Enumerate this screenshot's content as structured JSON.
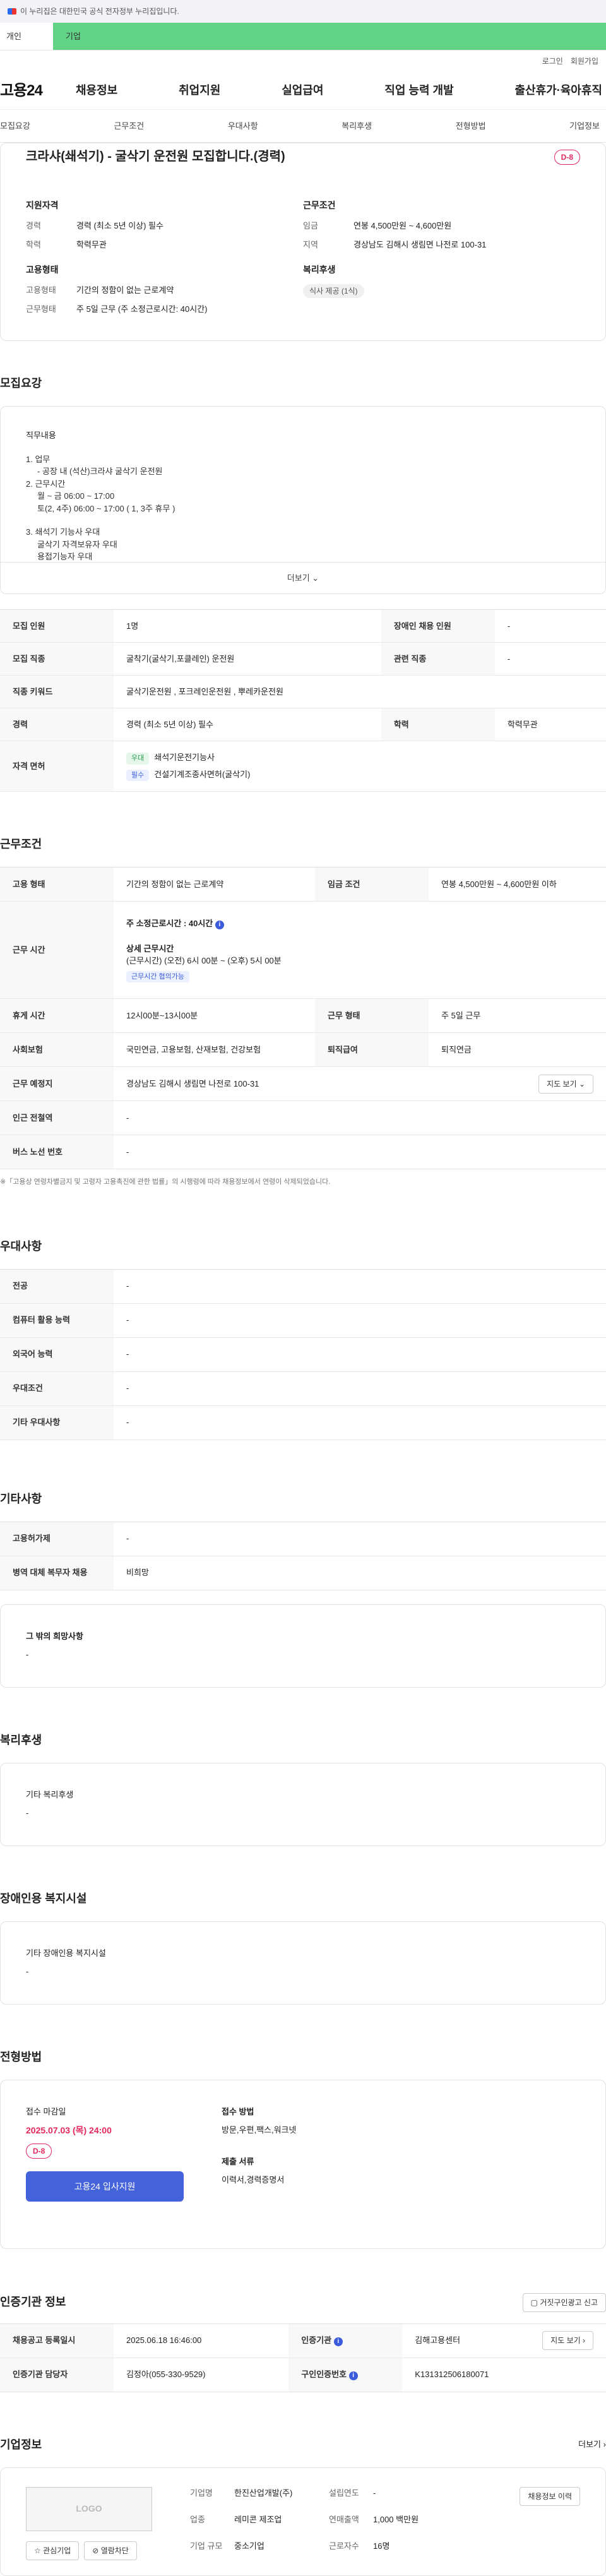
{
  "gov_bar": {
    "text": "이 누리집은 대한민국 공식 전자정부 누리집입니다."
  },
  "user_tabs": {
    "personal": "개인",
    "company": "기업"
  },
  "util": {
    "login": "로그인",
    "join": "회원가입"
  },
  "gnb": {
    "logo": "고용24",
    "items": [
      "채용정보",
      "취업지원",
      "실업급여",
      "직업 능력 개발",
      "출산휴가·육아휴직"
    ]
  },
  "snb": {
    "items": [
      "모집요강",
      "근무조건",
      "우대사항",
      "복리후생",
      "전형방법",
      "기업정보"
    ]
  },
  "top": {
    "title": "크라샤(쇄석기) - 굴삭기 운전원 모집합니다.(경력)",
    "dday": "D-8",
    "qualify_title": "지원자격",
    "career_k": "경력",
    "career_v": "경력 (최소 5년 이상) 필수",
    "edu_k": "학력",
    "edu_v": "학력무관",
    "employ_title": "고용형태",
    "etype_k": "고용형태",
    "etype_v": "기간의 정함이 없는 근로계약",
    "wtype_k": "근무형태",
    "wtype_v": "주 5일 근무 (주 소정근로시간: 40시간)",
    "cond_title": "근무조건",
    "wage_k": "임금",
    "wage_v": "연봉 4,500만원 ~ 4,600만원",
    "area_k": "지역",
    "area_v": "경상남도 김해시 생림면 나전로 100-31",
    "welfare_title": "복리후생",
    "welfare_pill": "식사 제공 (1식)"
  },
  "recruit": {
    "section_title": "모집요강",
    "duty_label": "직무내용",
    "lines": [
      "1. 업무",
      "- 공장 내 (석산)크라샤 굴삭기 운전원",
      "2. 근무시간",
      "월 ~ 금 06:00 ~ 17:00",
      "토(2, 4주) 06:00 ~ 17:00 ( 1, 3주 휴무 )",
      "3. 쇄석기 기능사 우대",
      "굴삭기 자격보유자 우대",
      "용접기능자 우대"
    ],
    "more": "더보기",
    "table": {
      "r1": [
        "모집 인원",
        "1명",
        "장애인 채용 인원",
        "-"
      ],
      "r2": [
        "모집 직종",
        "굴착기(굴삭기,포클레인) 운전원",
        "관련 직종",
        "-"
      ],
      "r3": [
        "직종 키워드",
        "굴삭기운전원 , 포크레인운전원 , 뿌레카운전원"
      ],
      "r4": [
        "경력",
        "경력 (최소 5년 이상) 필수",
        "학력",
        "학력무관"
      ],
      "r5_k": "자격 면허",
      "lic1_badge": "우대",
      "lic1": "쇄석기운전기능사",
      "lic2_badge": "필수",
      "lic2": "건설기계조종사면허(굴삭기)"
    }
  },
  "work": {
    "section_title": "근무조건",
    "etype": [
      "고용 형태",
      "기간의 정함이 없는 근로계약",
      "임금 조건",
      "연봉 4,500만원 ~ 4,600만원 이하"
    ],
    "hours_k": "근무 시간",
    "hours_main": "주 소정근로시간 : 40시간",
    "hours_detail_title": "상세 근무시간",
    "hours_detail": "(근무시간) (오전) 6시 00분 ~ (오후) 5시 00분",
    "hours_tag": "근무시간 협의가능",
    "rest": [
      "휴게 시간",
      "12시00분~13시00분",
      "근무 형태",
      "주 5일 근무"
    ],
    "insurance": [
      "사회보험",
      "국민연금, 고용보험, 산재보험, 건강보험",
      "퇴직급여",
      "퇴직연금"
    ],
    "place": [
      "근무 예정지",
      "경상남도 김해시 생림면 나전로 100-31"
    ],
    "map_btn": "지도 보기",
    "subway": [
      "인근 전철역",
      "-"
    ],
    "bus": [
      "버스 노선 번호",
      "-"
    ],
    "note": "※「고용상 연령차별금지 및 고령자 고용촉진에 관한 법률」의 시행령에 따라 채용정보에서 연령이 삭제되었습니다."
  },
  "pref": {
    "section_title": "우대사항",
    "rows": [
      [
        "전공",
        "-"
      ],
      [
        "컴퓨터 활용 능력",
        "-"
      ],
      [
        "외국어 능력",
        "-"
      ],
      [
        "우대조건",
        "-"
      ],
      [
        "기타 우대사항",
        "-"
      ]
    ]
  },
  "etc": {
    "section_title": "기타사항",
    "rows": [
      [
        "고용허가제",
        "-"
      ],
      [
        "병역 대체 복무자 채용",
        "비희망"
      ]
    ],
    "other_title": "그 밖의 희망사항",
    "other_value": "-"
  },
  "welfare": {
    "section_title": "복리후생",
    "label": "기타 복리후생",
    "value": "-"
  },
  "disabled": {
    "section_title": "장애인용 복지시설",
    "label": "기타 장애인용 복지시설",
    "value": "-"
  },
  "method": {
    "section_title": "전형방법",
    "deadline_label": "접수 마감일",
    "deadline": "2025.07.03 (목) 24:00",
    "dday": "D-8",
    "apply_btn": "고용24 입사지원",
    "how_label": "접수 방법",
    "how": "방문,우편,팩스,워크넷",
    "docs_label": "제출 서류",
    "docs": "이력서,경력증명서"
  },
  "agency": {
    "section_title": "인증기관 정보",
    "report_btn": "거짓구인광고 신고",
    "r1": [
      "채용공고 등록일시",
      "2025.06.18 16:46:00",
      "인증기관",
      "김해고용센터"
    ],
    "map_btn": "지도 보기",
    "r2": [
      "인증기관 담당자",
      "김정아(055-330-9529)",
      "구인인증번호",
      "K131312506180071"
    ]
  },
  "company": {
    "section_title": "기업정보",
    "more": "더보기",
    "logo": "LOGO",
    "name_k": "기업명",
    "name_v": "한진산업개발(주)",
    "founded_k": "설립연도",
    "founded_v": "-",
    "industry_k": "업종",
    "industry_v": "레미콘 제조업",
    "sales_k": "연매출액",
    "sales_v": "1,000 백만원",
    "size_k": "기업 규모",
    "size_v": "중소기업",
    "emp_k": "근로자수",
    "emp_v": "16명",
    "history_btn": "채용정보 이력",
    "fav_btn": "관심기업",
    "block_btn": "열람차단"
  }
}
